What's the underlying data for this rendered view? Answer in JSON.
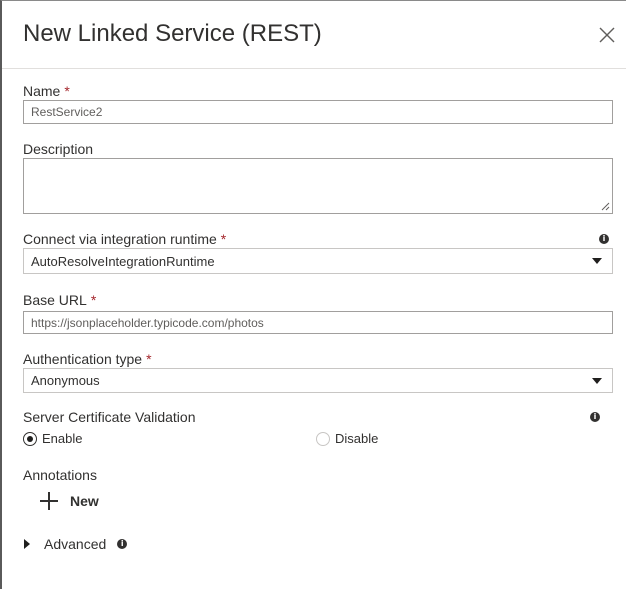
{
  "dialog": {
    "title": "New Linked Service (REST)"
  },
  "form": {
    "name": {
      "label": "Name",
      "value": "RestService2",
      "required_mark": "*"
    },
    "description": {
      "label": "Description",
      "value": ""
    },
    "runtime": {
      "label": "Connect via integration runtime",
      "required_mark": "*",
      "selected": "AutoResolveIntegrationRuntime"
    },
    "base_url": {
      "label": "Base URL",
      "required_mark": "*",
      "value": "https://jsonplaceholder.typicode.com/photos"
    },
    "auth": {
      "label": "Authentication type",
      "required_mark": "*",
      "selected": "Anonymous"
    },
    "cert_validation": {
      "label": "Server Certificate Validation",
      "options": [
        {
          "label": "Enable",
          "checked": true
        },
        {
          "label": "Disable",
          "checked": false
        }
      ]
    },
    "annotations": {
      "label": "Annotations",
      "new_label": "New"
    },
    "advanced": {
      "label": "Advanced"
    }
  },
  "icons": {
    "info": "i"
  },
  "colors": {
    "required": "#a4262c",
    "text": "#323130",
    "border": "#a19f9d"
  }
}
